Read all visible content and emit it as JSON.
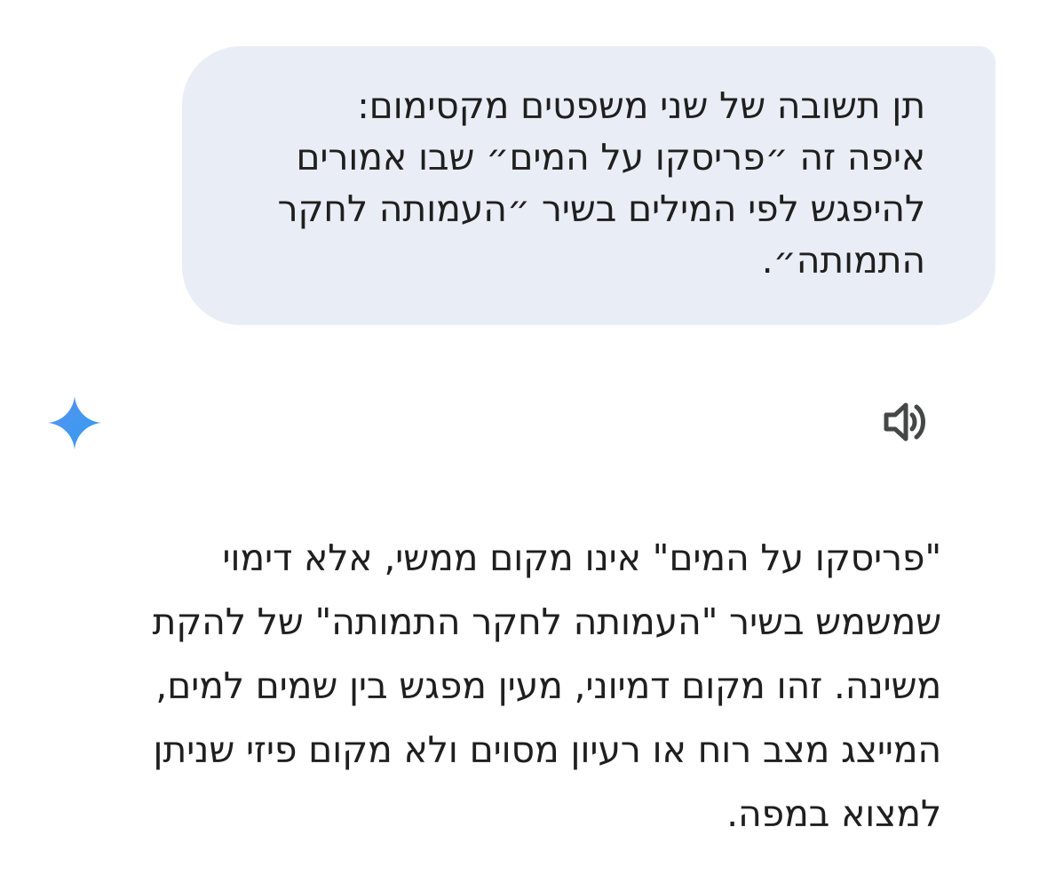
{
  "user_message": {
    "lines": [
      "תן תשובה של שני משפטים מקסימום:",
      "איפה זה ״פריסקו על המים״ שבו אמורים",
      "להיפגש לפי המילים בשיר ״העמותה לחקר",
      "התמותה״."
    ]
  },
  "assistant": {
    "icon": "gemini-sparkle-icon",
    "speaker_icon": "speaker-icon",
    "response_lines": [
      "\"פריסקו על המים\" אינו מקום ממשי, אלא דימוי",
      "שמשמש בשיר \"העמותה לחקר התמותה\" של להקת",
      "משינה. זהו מקום דמיוני, מעין מפגש בין שמים למים,",
      "המייצג מצב רוח או רעיון מסוים ולא מקום פיזי שניתן",
      "למצוא במפה."
    ]
  },
  "colors": {
    "bubble": "#e9eef6",
    "text": "#1f1f1f",
    "icon": "#444746",
    "sparkle_start": "#4f8df5",
    "sparkle_end": "#3aa0ea"
  }
}
